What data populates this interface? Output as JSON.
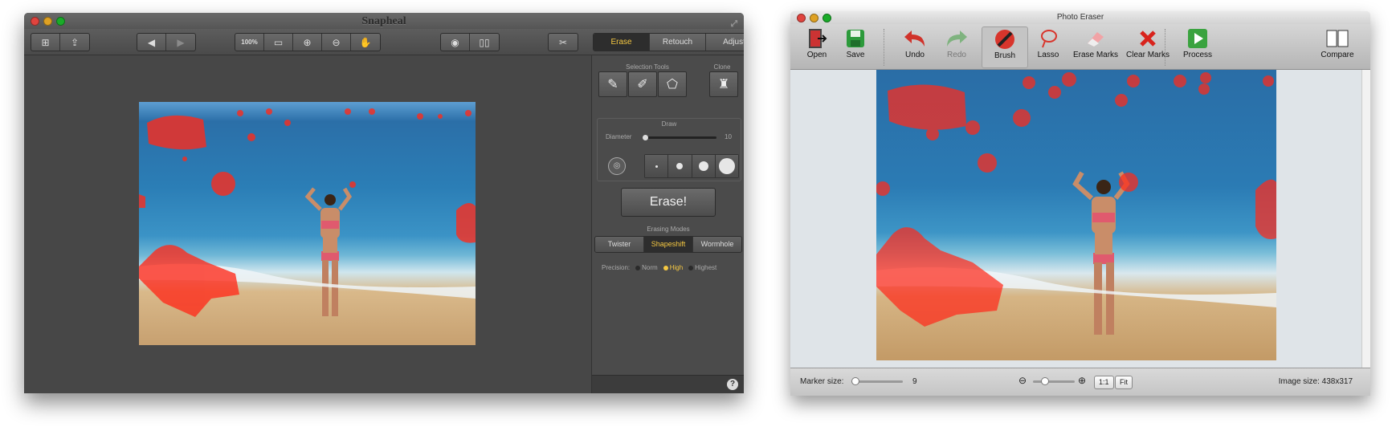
{
  "snapheal": {
    "title": "Snapheal",
    "mode_tabs": [
      "Erase",
      "Retouch",
      "Adjust"
    ],
    "zoom_actual_label": "100%",
    "sections": {
      "selection_tools": "Selection Tools",
      "clone": "Clone",
      "draw": "Draw",
      "erasing_modes": "Erasing Modes"
    },
    "diameter_label": "Diameter",
    "diameter_value": "10",
    "erase_button": "Erase!",
    "erasing_modes": [
      "Twister",
      "Shapeshift",
      "Wormhole"
    ],
    "precision_label": "Precision:",
    "precision_options": [
      "Norm",
      "High",
      "Highest"
    ],
    "help": "?",
    "accent": "#f5c842"
  },
  "photo_eraser": {
    "title": "Photo Eraser",
    "toolbar": {
      "open": "Open",
      "save": "Save",
      "undo": "Undo",
      "redo": "Redo",
      "brush": "Brush",
      "lasso": "Lasso",
      "erase_marks": "Erase Marks",
      "clear_marks": "Clear Marks",
      "process": "Process",
      "compare": "Compare"
    },
    "status": {
      "marker_size_label": "Marker size:",
      "marker_size_value": "9",
      "zoom_actual": "1:1",
      "zoom_fit": "Fit",
      "image_size": "Image size: 438x317"
    },
    "mark_color": "#ff2a1a"
  }
}
